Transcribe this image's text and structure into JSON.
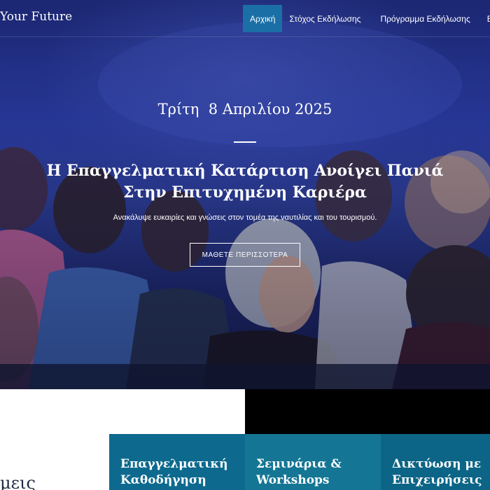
{
  "colors": {
    "nav_active_bg": "#1a6fa6",
    "hero_overlay": "#1f2b7a",
    "card_teal": "#0d6a8e",
    "card_teal_mid": "#147694",
    "black_block": "#000000"
  },
  "navbar": {
    "brand": "Your Future",
    "items": [
      {
        "label": "Αρχική",
        "active": true
      },
      {
        "label": "Στόχος Εκδήλωσης",
        "active": false
      },
      {
        "label": "Πρόγραμμα Εκδήλωσης",
        "active": false
      },
      {
        "label": "Επικοι",
        "active": false
      }
    ]
  },
  "hero": {
    "date": "Τρίτη  8 Απριλίου 2025",
    "title": "Η Επαγγελματική  Κατάρτιση Ανοίγει Πανιά\nΣτην Επιτυχημένη Καριέρα",
    "subtitle": "Ανακάλυψε ευκαιρίες και γνώσεις στον τομέα της ναυτιλίας και του τουρισμού.",
    "cta_label": "ΜΑΘΕΤΕ ΠΕΡΙΣΣΟΤΕΡΑ"
  },
  "section": {
    "partial_heading": "μεις"
  },
  "cards": [
    {
      "title": "Επαγγελματική\nΚαθοδήγηση"
    },
    {
      "title": "Σεμινάρια &\nWorkshops"
    },
    {
      "title": "Δικτύωση με\nΕπιχειρήσεις"
    }
  ]
}
